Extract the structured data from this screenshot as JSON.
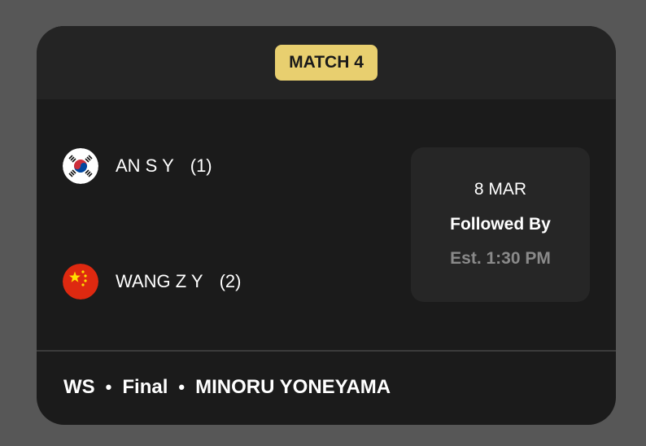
{
  "match": {
    "label": "MATCH 4"
  },
  "players": [
    {
      "name": "AN S Y",
      "seed": "(1)",
      "flag_icon": "south-korea-flag-icon"
    },
    {
      "name": "WANG Z Y",
      "seed": "(2)",
      "flag_icon": "china-flag-icon"
    }
  ],
  "schedule": {
    "date": "8 MAR",
    "order": "Followed By",
    "estimate": "Est. 1:30 PM"
  },
  "footer": {
    "event": "WS",
    "separator": "•",
    "round": "Final",
    "court": "MINORU YONEYAMA"
  },
  "colors": {
    "background": "#575757",
    "card": "#1b1b1b",
    "header": "#242424",
    "badge": "#e8cf6f",
    "info_box": "#262626",
    "muted_text": "#8a8a8a"
  }
}
